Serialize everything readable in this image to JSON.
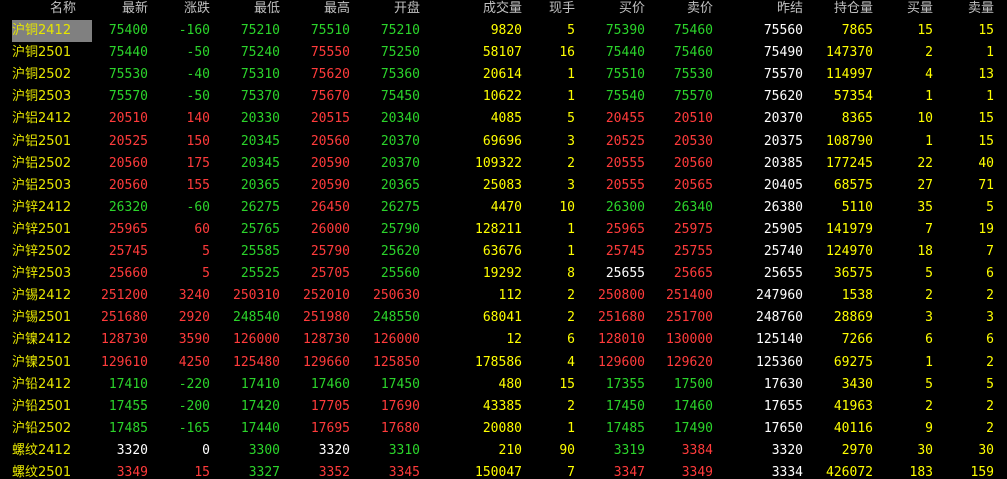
{
  "colors": {
    "up": "#ff3b3b",
    "down": "#2bd42b",
    "flat": "#ffffff",
    "volume": "#ffff00",
    "name": "#e6e600",
    "header": "#c0c0c0",
    "selected_bg": "#808080"
  },
  "header": {
    "name": "名称",
    "last": "最新",
    "change": "涨跌",
    "low": "最低",
    "high": "最高",
    "open": "开盘",
    "volume": "成交量",
    "current": "现手",
    "bid": "买价",
    "ask": "卖价",
    "prev_settle": "昨结",
    "open_interest": "持仓量",
    "bid_qty": "买量",
    "ask_qty": "卖量"
  },
  "rows": [
    {
      "name": "沪铜2412",
      "last": "75400",
      "change": "-160",
      "low": "75210",
      "high": "75510",
      "open": "75210",
      "volume": "9820",
      "current": "5",
      "bid": "75390",
      "ask": "75460",
      "prev_settle": "75560",
      "open_interest": "7865",
      "bid_qty": "15",
      "ask_qty": "15",
      "dir": "down",
      "selected": true
    },
    {
      "name": "沪铜2501",
      "last": "75440",
      "change": "-50",
      "low": "75240",
      "high": "75550",
      "open": "75250",
      "volume": "58107",
      "current": "16",
      "bid": "75440",
      "ask": "75460",
      "prev_settle": "75490",
      "open_interest": "147370",
      "bid_qty": "2",
      "ask_qty": "1",
      "dir": "down"
    },
    {
      "name": "沪铜2502",
      "last": "75530",
      "change": "-40",
      "low": "75310",
      "high": "75620",
      "open": "75360",
      "volume": "20614",
      "current": "1",
      "bid": "75510",
      "ask": "75530",
      "prev_settle": "75570",
      "open_interest": "114997",
      "bid_qty": "4",
      "ask_qty": "13",
      "dir": "down"
    },
    {
      "name": "沪铜2503",
      "last": "75570",
      "change": "-50",
      "low": "75370",
      "high": "75670",
      "open": "75450",
      "volume": "10622",
      "current": "1",
      "bid": "75540",
      "ask": "75570",
      "prev_settle": "75620",
      "open_interest": "57354",
      "bid_qty": "1",
      "ask_qty": "1",
      "dir": "down"
    },
    {
      "name": "沪铝2412",
      "last": "20510",
      "change": "140",
      "low": "20330",
      "high": "20515",
      "open": "20340",
      "volume": "4085",
      "current": "5",
      "bid": "20455",
      "ask": "20510",
      "prev_settle": "20370",
      "open_interest": "8365",
      "bid_qty": "10",
      "ask_qty": "15",
      "dir": "up"
    },
    {
      "name": "沪铝2501",
      "last": "20525",
      "change": "150",
      "low": "20345",
      "high": "20560",
      "open": "20370",
      "volume": "69696",
      "current": "3",
      "bid": "20525",
      "ask": "20530",
      "prev_settle": "20375",
      "open_interest": "108790",
      "bid_qty": "1",
      "ask_qty": "15",
      "dir": "up"
    },
    {
      "name": "沪铝2502",
      "last": "20560",
      "change": "175",
      "low": "20345",
      "high": "20590",
      "open": "20370",
      "volume": "109322",
      "current": "2",
      "bid": "20555",
      "ask": "20560",
      "prev_settle": "20385",
      "open_interest": "177245",
      "bid_qty": "22",
      "ask_qty": "40",
      "dir": "up"
    },
    {
      "name": "沪铝2503",
      "last": "20560",
      "change": "155",
      "low": "20365",
      "high": "20590",
      "open": "20365",
      "volume": "25083",
      "current": "3",
      "bid": "20555",
      "ask": "20565",
      "prev_settle": "20405",
      "open_interest": "68575",
      "bid_qty": "27",
      "ask_qty": "71",
      "dir": "up"
    },
    {
      "name": "沪锌2412",
      "last": "26320",
      "change": "-60",
      "low": "26275",
      "high": "26450",
      "open": "26275",
      "volume": "4470",
      "current": "10",
      "bid": "26300",
      "ask": "26340",
      "prev_settle": "26380",
      "open_interest": "5110",
      "bid_qty": "35",
      "ask_qty": "5",
      "dir": "down"
    },
    {
      "name": "沪锌2501",
      "last": "25965",
      "change": "60",
      "low": "25765",
      "high": "26000",
      "open": "25790",
      "volume": "128211",
      "current": "1",
      "bid": "25965",
      "ask": "25975",
      "prev_settle": "25905",
      "open_interest": "141979",
      "bid_qty": "7",
      "ask_qty": "19",
      "dir": "up"
    },
    {
      "name": "沪锌2502",
      "last": "25745",
      "change": "5",
      "low": "25585",
      "high": "25790",
      "open": "25620",
      "volume": "63676",
      "current": "1",
      "bid": "25745",
      "ask": "25755",
      "prev_settle": "25740",
      "open_interest": "124970",
      "bid_qty": "18",
      "ask_qty": "7",
      "dir": "up"
    },
    {
      "name": "沪锌2503",
      "last": "25660",
      "change": "5",
      "low": "25525",
      "high": "25705",
      "open": "25560",
      "volume": "19292",
      "current": "8",
      "bid": "25655",
      "ask": "25665",
      "prev_settle": "25655",
      "open_interest": "36575",
      "bid_qty": "5",
      "ask_qty": "6",
      "dir": "up",
      "bid_flat": true
    },
    {
      "name": "沪锡2412",
      "last": "251200",
      "change": "3240",
      "low": "250310",
      "high": "252010",
      "open": "250630",
      "volume": "112",
      "current": "2",
      "bid": "250800",
      "ask": "251400",
      "prev_settle": "247960",
      "open_interest": "1538",
      "bid_qty": "2",
      "ask_qty": "2",
      "dir": "up"
    },
    {
      "name": "沪锡2501",
      "last": "251680",
      "change": "2920",
      "low": "248540",
      "high": "251980",
      "open": "248550",
      "volume": "68041",
      "current": "2",
      "bid": "251680",
      "ask": "251700",
      "prev_settle": "248760",
      "open_interest": "28869",
      "bid_qty": "3",
      "ask_qty": "3",
      "dir": "up"
    },
    {
      "name": "沪镍2412",
      "last": "128730",
      "change": "3590",
      "low": "126000",
      "high": "128730",
      "open": "126000",
      "volume": "12",
      "current": "6",
      "bid": "128010",
      "ask": "130000",
      "prev_settle": "125140",
      "open_interest": "7266",
      "bid_qty": "6",
      "ask_qty": "6",
      "dir": "up"
    },
    {
      "name": "沪镍2501",
      "last": "129610",
      "change": "4250",
      "low": "125480",
      "high": "129660",
      "open": "125850",
      "volume": "178586",
      "current": "4",
      "bid": "129600",
      "ask": "129620",
      "prev_settle": "125360",
      "open_interest": "69275",
      "bid_qty": "1",
      "ask_qty": "2",
      "dir": "up"
    },
    {
      "name": "沪铅2412",
      "last": "17410",
      "change": "-220",
      "low": "17410",
      "high": "17460",
      "open": "17450",
      "volume": "480",
      "current": "15",
      "bid": "17355",
      "ask": "17500",
      "prev_settle": "17630",
      "open_interest": "3430",
      "bid_qty": "5",
      "ask_qty": "5",
      "dir": "down"
    },
    {
      "name": "沪铅2501",
      "last": "17455",
      "change": "-200",
      "low": "17420",
      "high": "17705",
      "open": "17690",
      "volume": "43385",
      "current": "2",
      "bid": "17450",
      "ask": "17460",
      "prev_settle": "17655",
      "open_interest": "41963",
      "bid_qty": "2",
      "ask_qty": "2",
      "dir": "down"
    },
    {
      "name": "沪铅2502",
      "last": "17485",
      "change": "-165",
      "low": "17440",
      "high": "17695",
      "open": "17680",
      "volume": "20080",
      "current": "1",
      "bid": "17485",
      "ask": "17490",
      "prev_settle": "17650",
      "open_interest": "40116",
      "bid_qty": "9",
      "ask_qty": "2",
      "dir": "down"
    },
    {
      "name": "螺纹2412",
      "last": "3320",
      "change": "0",
      "low": "3300",
      "high": "3320",
      "open": "3310",
      "volume": "210",
      "current": "90",
      "bid": "3319",
      "ask": "3384",
      "prev_settle": "3320",
      "open_interest": "2970",
      "bid_qty": "30",
      "ask_qty": "30",
      "dir": "flat"
    },
    {
      "name": "螺纹2501",
      "last": "3349",
      "change": "15",
      "low": "3327",
      "high": "3352",
      "open": "3345",
      "volume": "150047",
      "current": "7",
      "bid": "3347",
      "ask": "3349",
      "prev_settle": "3334",
      "open_interest": "426072",
      "bid_qty": "183",
      "ask_qty": "159",
      "dir": "up"
    }
  ]
}
